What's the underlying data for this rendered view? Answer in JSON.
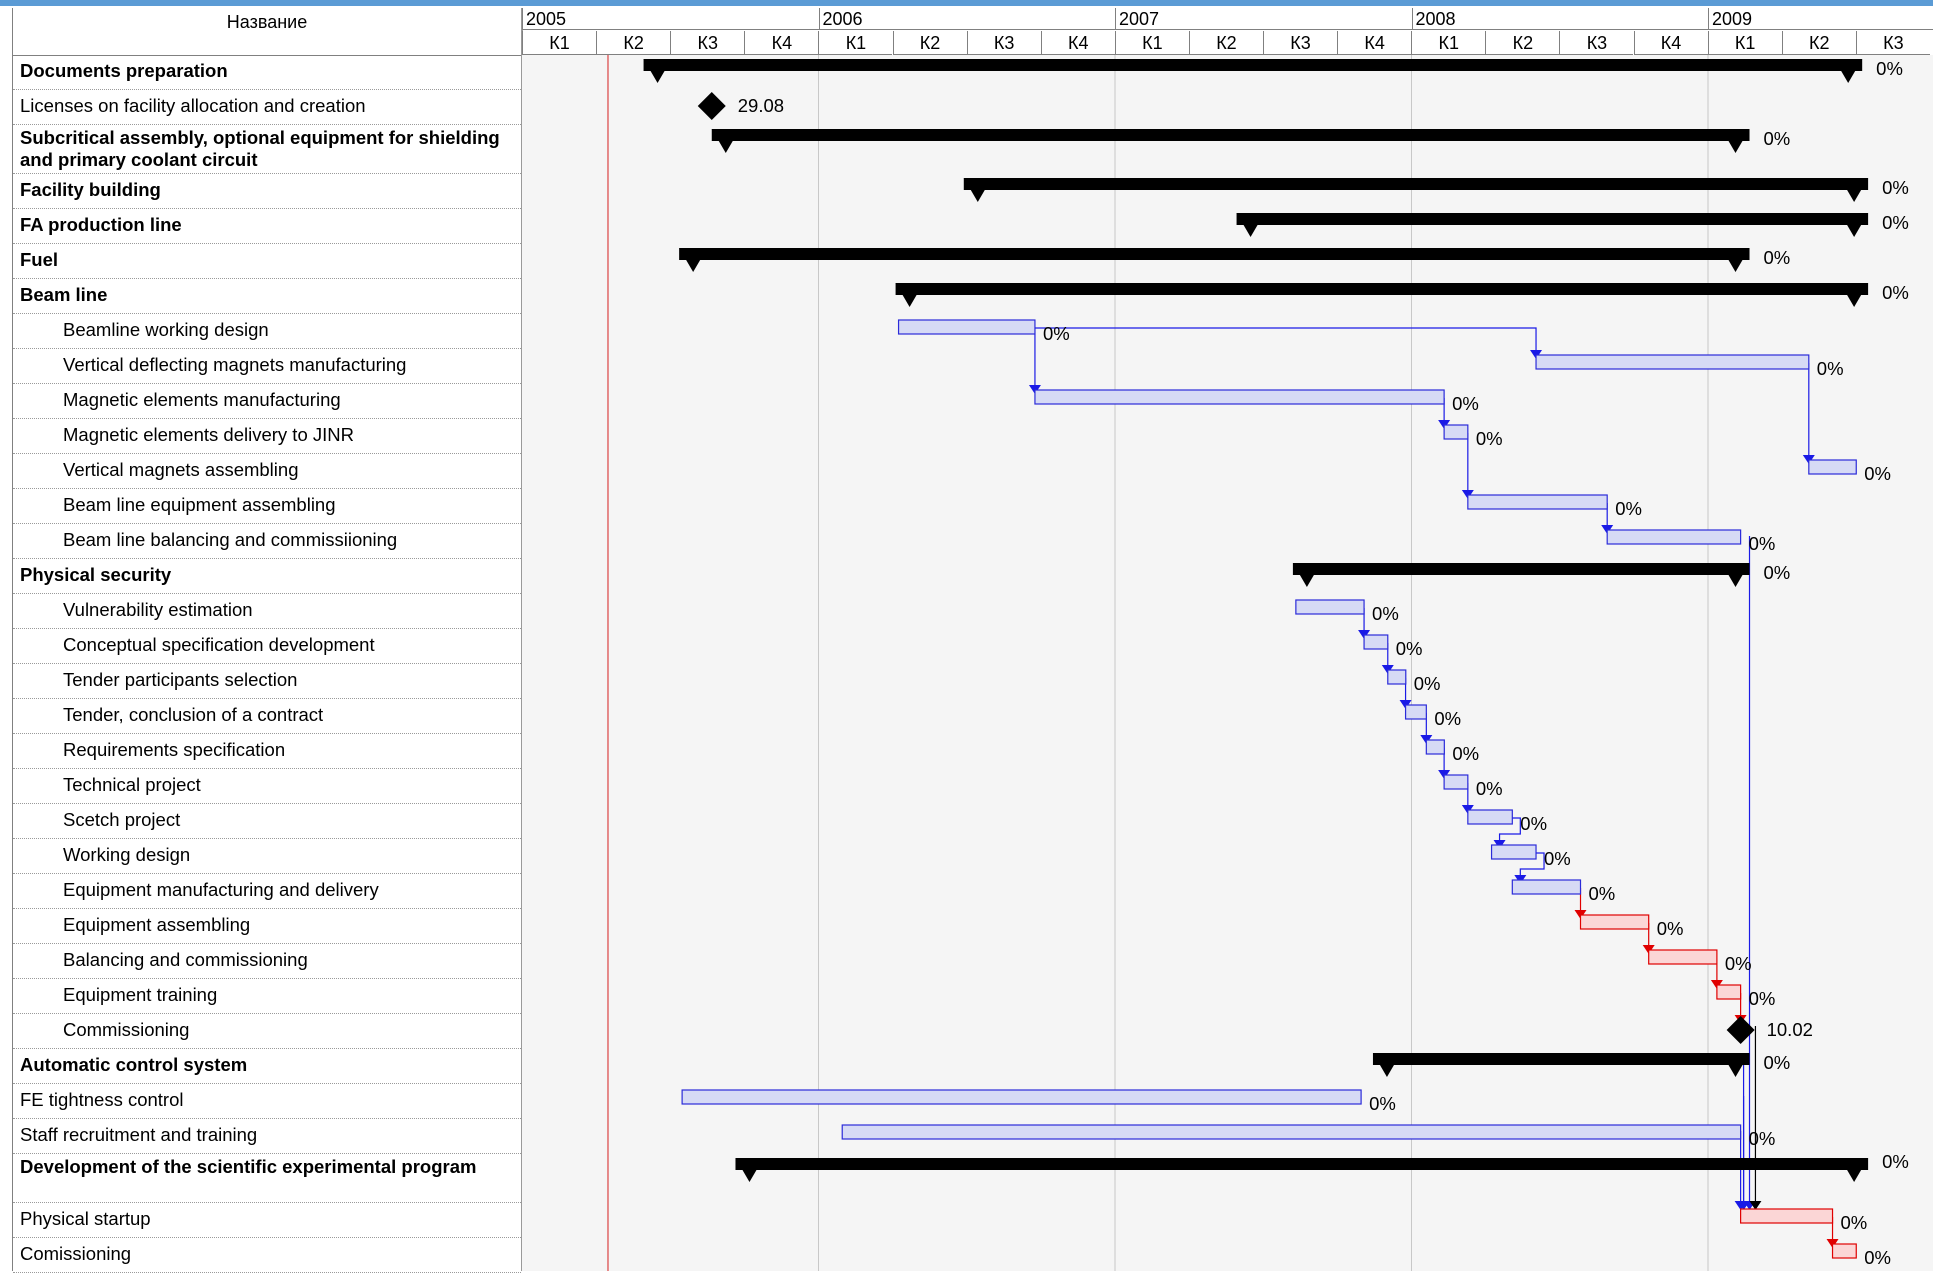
{
  "header": {
    "name_column": "Название"
  },
  "timescale": {
    "years": [
      "2005",
      "2006",
      "2007",
      "2008",
      "2009"
    ],
    "quarters": [
      "К1",
      "К2",
      "К3",
      "К4",
      "К1",
      "К2",
      "К3",
      "К4",
      "К1",
      "К2",
      "К3",
      "К4",
      "К1",
      "К2",
      "К3",
      "К4",
      "К1",
      "К2",
      "К3"
    ]
  },
  "colors": {
    "summary": "#000000",
    "task_fill": "#d6daf5",
    "task_border": "#2b2bd9",
    "critical_fill": "#fbd6d6",
    "critical_border": "#e00000",
    "link": "#1a1ae6",
    "critical_link": "#e00000",
    "today_line": "#e06666"
  },
  "tasks": [
    {
      "name": "Documents preparation",
      "level": 0,
      "bold": true,
      "type": "summary",
      "start": 0.41,
      "finish": 4.52,
      "label": "0%"
    },
    {
      "name": "Licenses on facility allocation and creation",
      "level": 0,
      "bold": false,
      "type": "milestone",
      "start": 0.64,
      "finish": 0.64,
      "label": "29.08"
    },
    {
      "name": "Subcritical assembly, optional  equipment for shielding and primary coolant circuit",
      "level": 0,
      "bold": true,
      "type": "summary",
      "start": 0.64,
      "finish": 4.14,
      "label": "0%"
    },
    {
      "name": "Facility building",
      "level": 0,
      "bold": true,
      "type": "summary",
      "start": 1.49,
      "finish": 4.54,
      "label": "0%"
    },
    {
      "name": "FA production line",
      "level": 0,
      "bold": true,
      "type": "summary",
      "start": 2.41,
      "finish": 4.54,
      "label": "0%"
    },
    {
      "name": "Fuel",
      "level": 0,
      "bold": true,
      "type": "summary",
      "start": 0.53,
      "finish": 4.14,
      "label": "0%"
    },
    {
      "name": "Beam line",
      "level": 0,
      "bold": true,
      "type": "summary",
      "start": 1.26,
      "finish": 4.54,
      "label": "0%"
    },
    {
      "name": "Beamline working design",
      "level": 1,
      "bold": false,
      "type": "task",
      "start": 1.27,
      "finish": 1.73,
      "label": "0%"
    },
    {
      "name": "Vertical deflecting magnets manufacturing",
      "level": 1,
      "bold": false,
      "type": "task",
      "start": 3.42,
      "finish": 4.34,
      "label": "0%"
    },
    {
      "name": "Magnetic elements manufacturing",
      "level": 1,
      "bold": false,
      "type": "task",
      "start": 1.73,
      "finish": 3.11,
      "label": "0%"
    },
    {
      "name": "Magnetic elements delivery to JINR",
      "level": 1,
      "bold": false,
      "type": "task",
      "start": 3.11,
      "finish": 3.19,
      "label": "0%"
    },
    {
      "name": "Vertical magnets assembling",
      "level": 1,
      "bold": false,
      "type": "task",
      "start": 4.34,
      "finish": 4.5,
      "label": "0%"
    },
    {
      "name": "Beam line equipment assembling",
      "level": 1,
      "bold": false,
      "type": "task",
      "start": 3.19,
      "finish": 3.66,
      "label": "0%"
    },
    {
      "name": "Beam line balancing and commissiioning",
      "level": 1,
      "bold": false,
      "type": "task",
      "start": 3.66,
      "finish": 4.11,
      "label": "0%"
    },
    {
      "name": "Physical security",
      "level": 0,
      "bold": true,
      "type": "summary",
      "start": 2.6,
      "finish": 4.14,
      "label": "0%"
    },
    {
      "name": "Vulnerability estimation",
      "level": 1,
      "bold": false,
      "type": "task",
      "start": 2.61,
      "finish": 2.84,
      "label": "0%"
    },
    {
      "name": "Conceptual specification development",
      "level": 1,
      "bold": false,
      "type": "task",
      "start": 2.84,
      "finish": 2.92,
      "label": "0%"
    },
    {
      "name": "Tender participants selection",
      "level": 1,
      "bold": false,
      "type": "task",
      "start": 2.92,
      "finish": 2.98,
      "label": "0%"
    },
    {
      "name": "Tender, conclusion of a contract",
      "level": 1,
      "bold": false,
      "type": "task",
      "start": 2.98,
      "finish": 3.05,
      "label": "0%"
    },
    {
      "name": "Requirements specification",
      "level": 1,
      "bold": false,
      "type": "task",
      "start": 3.05,
      "finish": 3.11,
      "label": "0%"
    },
    {
      "name": "Technical project",
      "level": 1,
      "bold": false,
      "type": "task",
      "start": 3.11,
      "finish": 3.19,
      "label": "0%"
    },
    {
      "name": "Scetch project",
      "level": 1,
      "bold": false,
      "type": "task",
      "start": 3.19,
      "finish": 3.34,
      "label": "0%"
    },
    {
      "name": "Working design",
      "level": 1,
      "bold": false,
      "type": "task",
      "start": 3.27,
      "finish": 3.42,
      "label": "0%"
    },
    {
      "name": "Equipment manufacturing and delivery",
      "level": 1,
      "bold": false,
      "type": "task",
      "start": 3.34,
      "finish": 3.57,
      "label": "0%"
    },
    {
      "name": "Equipment assembling",
      "level": 1,
      "bold": false,
      "type": "critical",
      "start": 3.57,
      "finish": 3.8,
      "label": "0%"
    },
    {
      "name": "Balancing and commissioning",
      "level": 1,
      "bold": false,
      "type": "critical",
      "start": 3.8,
      "finish": 4.03,
      "label": "0%"
    },
    {
      "name": "Equipment training",
      "level": 1,
      "bold": false,
      "type": "critical",
      "start": 4.03,
      "finish": 4.11,
      "label": "0%"
    },
    {
      "name": "Commissioning",
      "level": 1,
      "bold": false,
      "type": "milestone",
      "start": 4.11,
      "finish": 4.11,
      "label": "10.02"
    },
    {
      "name": "Automatic control system",
      "level": 0,
      "bold": true,
      "type": "summary",
      "start": 2.87,
      "finish": 4.14,
      "label": "0%"
    },
    {
      "name": "FE tightness control",
      "level": 0,
      "bold": false,
      "type": "task",
      "start": 0.54,
      "finish": 2.83,
      "label": "0%"
    },
    {
      "name": "Staff recruitment and training",
      "level": 0,
      "bold": false,
      "type": "task",
      "start": 1.08,
      "finish": 4.11,
      "label": "0%"
    },
    {
      "name": "Development of the scientific experimental program",
      "level": 0,
      "bold": true,
      "type": "summary",
      "start": 0.72,
      "finish": 4.54,
      "label": "0%"
    },
    {
      "name": "Physical startup",
      "level": 0,
      "bold": false,
      "type": "critical",
      "start": 4.11,
      "finish": 4.42,
      "label": "0%"
    },
    {
      "name": "Comissioning",
      "level": 0,
      "bold": false,
      "type": "critical",
      "start": 4.42,
      "finish": 4.5,
      "label": "0%"
    }
  ]
}
